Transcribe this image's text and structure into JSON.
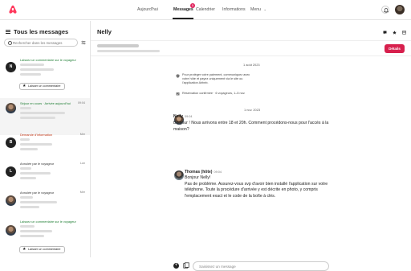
{
  "topnav": {
    "items": [
      "Aujourd'hui",
      "Messages",
      "Calendrier",
      "Informations",
      "Menu"
    ],
    "badge": "1"
  },
  "sidebar": {
    "title": "Tous les messages",
    "search_placeholder": "Rechercher dans les messages",
    "conversations": [
      {
        "avatar": "N",
        "status": "Laissez un commentaire sur le voyageur",
        "date": "",
        "button": "Laisser un commentaire"
      },
      {
        "avatar": "",
        "status": "Séjour en cours · Arrivée aujourd'hui",
        "date": "09:04",
        "button": ""
      },
      {
        "avatar": "B",
        "status": "Demande d'information",
        "date": "Mer",
        "button": ""
      },
      {
        "avatar": "L",
        "status": "Annulée par le voyageur",
        "date": "Lun",
        "button": ""
      },
      {
        "avatar": "",
        "status": "Annulée par le voyageur",
        "date": "Mer",
        "button": ""
      },
      {
        "avatar": "",
        "status": "Laissez un commentaire sur le voyageur",
        "date": "",
        "button": "Laisser un commentaire"
      }
    ]
  },
  "chat": {
    "title": "Nelly",
    "details_label": "Détails",
    "day1": "1 août 2023",
    "sys1": "Pour protéger votre paiement, communiquez avec votre hôte et payez uniquement via le site ou l'application Airbnb.",
    "sys2": "Réservation confirmée · 6 voyageurs, 1–5 nov.",
    "day2": "1 nov. 2023",
    "messages": [
      {
        "name": "Nelly",
        "time": "09:04",
        "text": "Bonjour ! Nous arrivons entre 18 et 20h. Comment procédons-nous pour l'accès à la maison?"
      },
      {
        "name": "Thomas (hôte)",
        "time": "09:04",
        "text": "Bonjour Nelly!\nPas de problème. Assurez-vous svp d'avoir bien installé l'application sur votre téléphone. Toute la procédure d'arrivée y est décrite en photo, y compris l'emplacement exact et le code de la boîte à clés."
      }
    ],
    "composer_placeholder": "Saisissez un message"
  },
  "colors": {
    "accent": "#d7204d",
    "green": "#1d7d32",
    "red": "#c13515"
  }
}
